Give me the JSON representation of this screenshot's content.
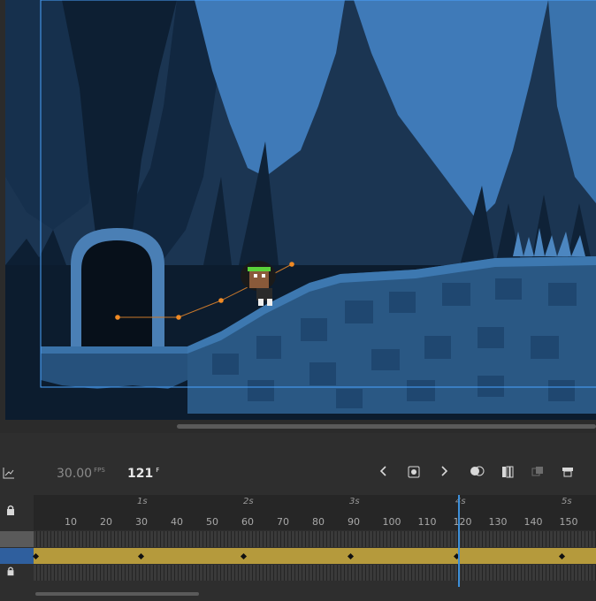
{
  "timeline": {
    "fps_value": "30.00",
    "fps_unit": "FPS",
    "current_frame": "121",
    "frame_unit": "F"
  },
  "ruler": {
    "seconds": [
      "1s",
      "2s",
      "3s",
      "4s",
      "5s"
    ],
    "frame_ticks": [
      "10",
      "20",
      "30",
      "40",
      "50",
      "60",
      "70",
      "80",
      "90",
      "100",
      "110",
      "120",
      "130",
      "140",
      "150"
    ]
  },
  "colors": {
    "tween_track": "#b59a3c",
    "selected_layer": "#2f5f9e",
    "playhead": "#3d8fd9"
  },
  "icons": [
    "graph-icon",
    "lock-icon",
    "prev-keyframe-icon",
    "insert-keyframe-icon",
    "next-keyframe-icon",
    "onion-skin-icon",
    "edit-multiple-frames-icon",
    "paste-icon",
    "camera-icon"
  ]
}
